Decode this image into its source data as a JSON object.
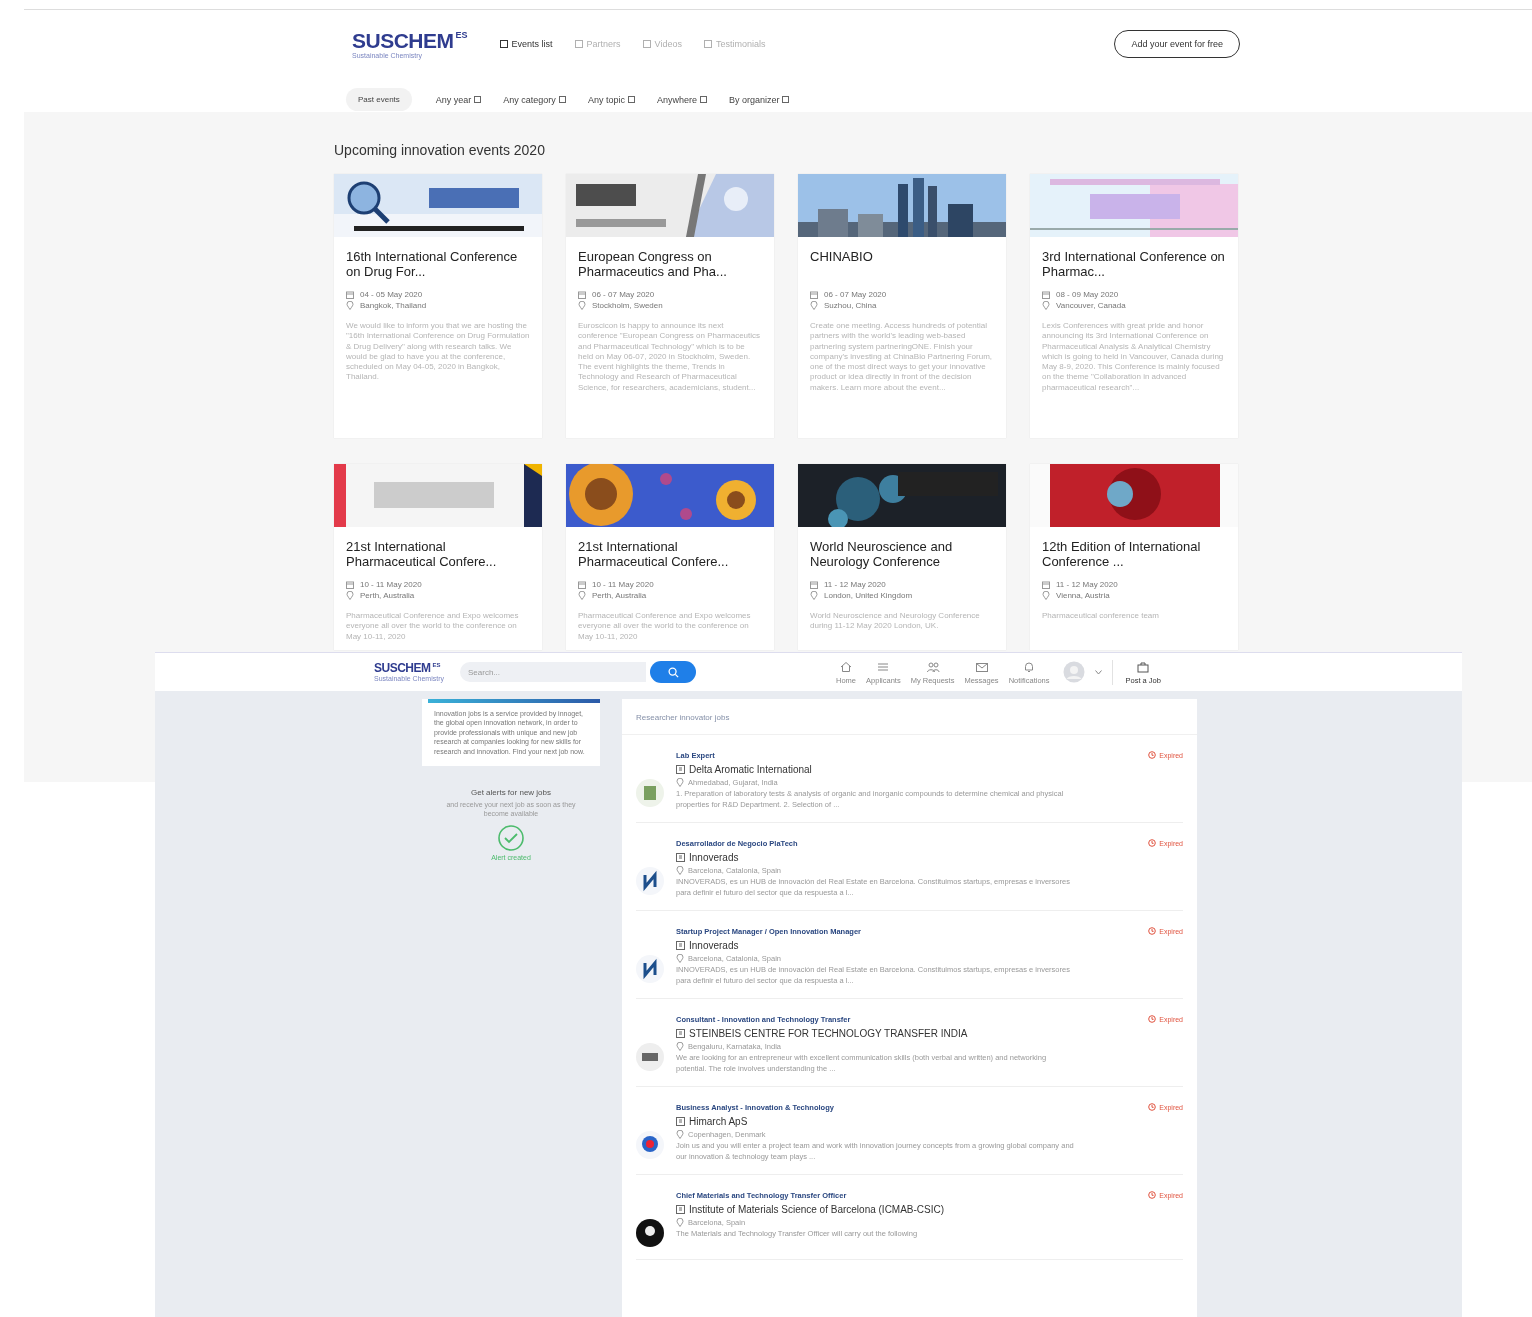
{
  "events_site": {
    "logo": {
      "name": "SUSCHEM",
      "superscript": "ES",
      "tagline": "Sustainable Chemistry"
    },
    "nav": [
      {
        "label": "Events list",
        "selected": true
      },
      {
        "label": "Partners",
        "selected": false
      },
      {
        "label": "Videos",
        "selected": false
      },
      {
        "label": "Testimonials",
        "selected": false
      }
    ],
    "add_button": "Add your event for free",
    "filters": [
      {
        "label": "Past events",
        "kind": "pill"
      },
      {
        "label": "Any year",
        "kind": "dropdown"
      },
      {
        "label": "Any category",
        "kind": "dropdown"
      },
      {
        "label": "Any topic",
        "kind": "dropdown"
      },
      {
        "label": "Anywhere",
        "kind": "dropdown"
      },
      {
        "label": "By organizer",
        "kind": "dropdown"
      }
    ],
    "heading": "Upcoming innovation events 2020",
    "events": [
      {
        "title": "16th International Conference on Drug For...",
        "date": "04 - 05 May 2020",
        "place": "Bangkok, Thailand",
        "description": "We would like to inform you that we are hosting the \"16th International Conference on Drug Formulation & Drug Delivery\" along with research talks. We would be glad to have you at the conference, scheduled on May 04-05, 2020 in Bangkok, Thailand."
      },
      {
        "title": "European Congress on Pharmaceutics and Pha...",
        "date": "06 - 07 May 2020",
        "place": "Stockholm, Sweden",
        "description": "Euroscicon is happy to announce its next conference \"European Congress on Pharmaceutics and Pharmaceutical Technology\" which is to be held on May 06-07, 2020 in Stockholm, Sweden. The event highlights the theme, Trends in Technology and Research of Pharmaceutical Science, for researchers, academicians, student..."
      },
      {
        "title": "CHINABIO",
        "date": "06 - 07 May 2020",
        "place": "Suzhou, China",
        "description": "Create one meeting. Access hundreds of potential partners with the world's leading web-based partnering system partneringONE. Finish your company's investing at ChinaBio Partnering Forum, one of the most direct ways to get your innovative product or idea directly in front of the decision makers. Learn more about the event..."
      },
      {
        "title": "3rd International Conference on Pharmac...",
        "date": "08 - 09 May 2020",
        "place": "Vancouver, Canada",
        "description": "Lexis Conferences with great pride and honor announcing its 3rd International Conference on Pharmaceutical Analysis & Analytical Chemistry which is going to held in Vancouver, Canada during May 8-9, 2020. This Conference is mainly focused on the theme \"Collaboration in advanced pharmaceutical research\"..."
      },
      {
        "title": "21st International Pharmaceutical Confere...",
        "date": "10 - 11 May 2020",
        "place": "Perth, Australia",
        "description": "Pharmaceutical Conference and Expo welcomes everyone all over the world to the conference on May 10-11, 2020"
      },
      {
        "title": "21st International Pharmaceutical Confere...",
        "date": "10 - 11 May 2020",
        "place": "Perth, Australia",
        "description": "Pharmaceutical Conference and Expo welcomes everyone all over the world to the conference on May 10-11, 2020"
      },
      {
        "title": "World Neuroscience and Neurology Conference",
        "date": "11 - 12 May 2020",
        "place": "London, United Kingdom",
        "description": "World Neuroscience and Neurology Conference during 11-12 May 2020 London, UK."
      },
      {
        "title": "12th Edition of International Conference ...",
        "date": "11 - 12 May 2020",
        "place": "Vienna, Austria",
        "description": "Pharmaceutical conference team"
      }
    ]
  },
  "jobs_site": {
    "logo": {
      "name": "SUSCHEM",
      "superscript": "ES",
      "tagline": "Sustainable Chemistry"
    },
    "search": {
      "placeholder": "Search..."
    },
    "nav": [
      {
        "label": "Home",
        "kind": "home"
      },
      {
        "label": "Applicants",
        "kind": "list"
      },
      {
        "label": "My Requests",
        "kind": "people"
      },
      {
        "label": "Messages",
        "kind": "mail"
      },
      {
        "label": "Notifications",
        "kind": "bell"
      }
    ],
    "post_button": "Post a Job",
    "sidebar": {
      "info": "Innovation jobs is a service provided by innoget, the global open innovation network, in order to provide professionals with unique and new job research at companies looking for new skills for research and innovation. Find your next job now.",
      "alert_title": "Get alerts for new jobs",
      "alert_text": "and receive your next job as soon as they become available",
      "alert_status": "Alert created"
    },
    "section_title": "Researcher innovator jobs",
    "jobs": [
      {
        "role": "Lab Expert",
        "company": "Delta Aromatic International",
        "location": "Ahmedabad, Gujarat, India",
        "description": "1. Preparation of laboratory tests & analysis of organic and inorganic compounds to determine chemical and physical properties for R&D Department. 2. Selection of ...",
        "status": "Expired"
      },
      {
        "role": "Desarrollador de Negocio PlaTech",
        "company": "Innoverads",
        "location": "Barcelona, Catalonia, Spain",
        "description": "INNOVERADS, es un HUB de innovación del Real Estate en Barcelona. Constituimos startups, empresas e inversores para definir el futuro del sector que da respuesta a l...",
        "status": "Expired"
      },
      {
        "role": "Startup Project Manager / Open Innovation Manager",
        "company": "Innoverads",
        "location": "Barcelona, Catalonia, Spain",
        "description": "INNOVERADS, es un HUB de innovación del Real Estate en Barcelona. Constituimos startups, empresas e inversores para definir el futuro del sector que da respuesta a l...",
        "status": "Expired"
      },
      {
        "role": "Consultant - Innovation and Technology Transfer",
        "company": "STEINBEIS CENTRE FOR TECHNOLOGY TRANSFER INDIA",
        "location": "Bengaluru, Karnataka, India",
        "description": "We are looking for an entrepreneur with excellent communication skills (both verbal and written) and networking potential. The role involves understanding the ...",
        "status": "Expired"
      },
      {
        "role": "Business Analyst - Innovation & Technology",
        "company": "Himarch ApS",
        "location": "Copenhagen, Denmark",
        "description": "Join us and you will enter a project team and work with innovation journey concepts from a growing global company and our innovation & technology team plays ...",
        "status": "Expired"
      },
      {
        "role": "Chief Materials and Technology Transfer Officer",
        "company": "Institute of Materials Science of Barcelona (ICMAB-CSIC)",
        "location": "Barcelona, Spain",
        "description": "The Materials and Technology Transfer Officer will carry out the following",
        "status": "Expired"
      }
    ]
  }
}
